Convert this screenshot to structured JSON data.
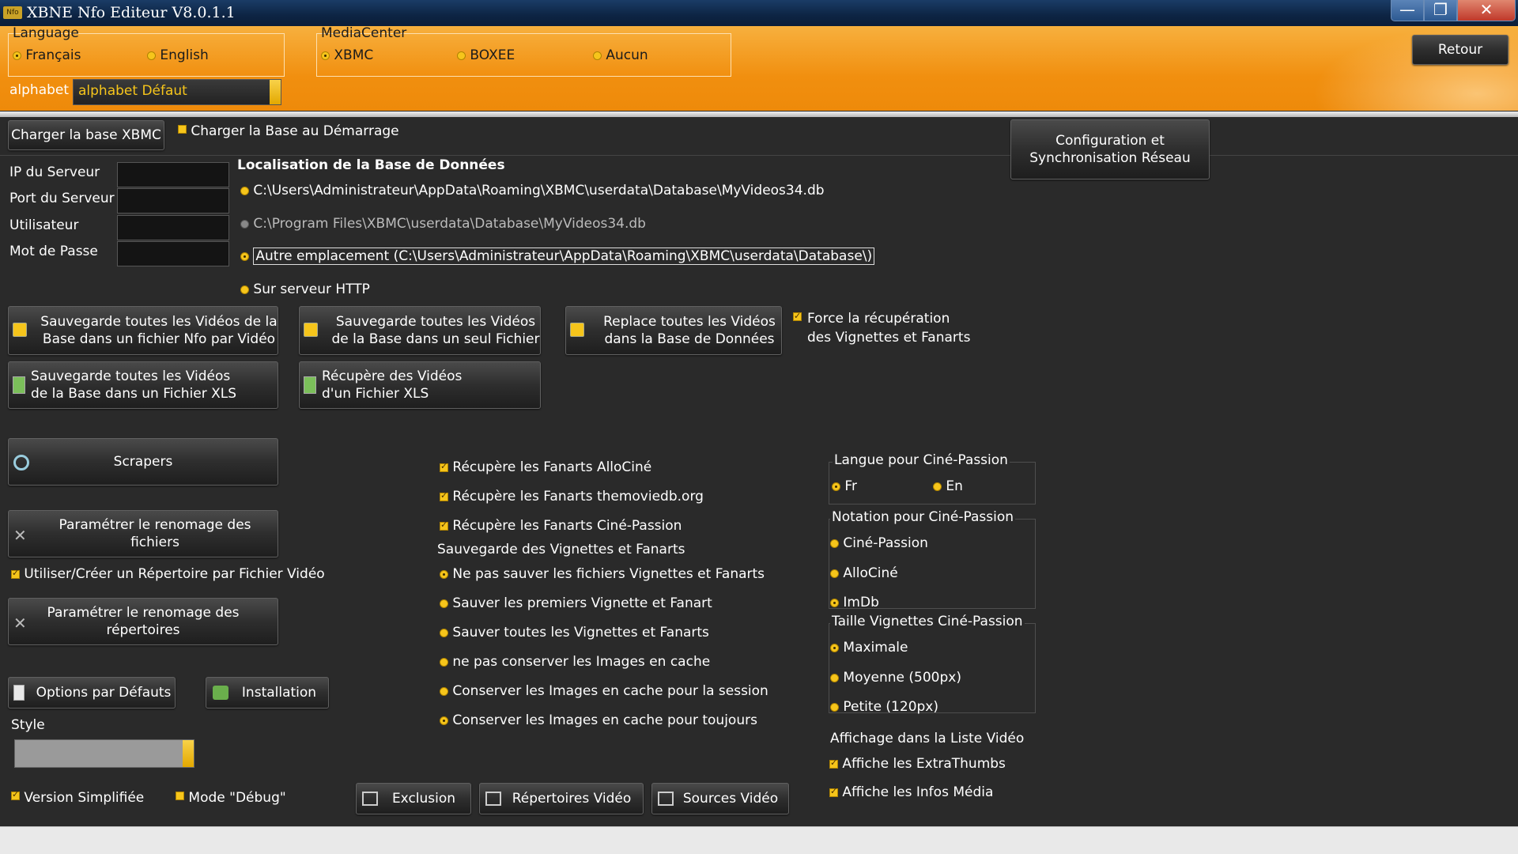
{
  "window": {
    "title": "XBNE Nfo Editeur V8.0.1.1",
    "icon_text": "Nfo",
    "minimize": "—",
    "maximize": "❐",
    "close": "✕"
  },
  "language": {
    "group_title": "Language",
    "options": [
      "Français",
      "English"
    ],
    "selected": "Français"
  },
  "mediacenter": {
    "group_title": "MediaCenter",
    "options": [
      "XBMC",
      "BOXEE",
      "Aucun"
    ],
    "selected": "XBMC"
  },
  "alphabet": {
    "label": "alphabet",
    "value": "alphabet Défaut"
  },
  "retour_button": "Retour",
  "load_base_button": "Charger la base XBMC",
  "load_on_start": "Charger la Base au Démarrage",
  "network_config_button": {
    "line1": "Configuration et",
    "line2": "Synchronisation Réseau"
  },
  "server": {
    "ip_label": "IP du Serveur",
    "port_label": "Port du Serveur",
    "user_label": "Utilisateur",
    "password_label": "Mot de Passe"
  },
  "db_location": {
    "title": "Localisation de la Base de Données",
    "options": [
      "C:\\Users\\Administrateur\\AppData\\Roaming\\XBMC\\userdata\\Database\\MyVideos34.db",
      "C:\\Program Files\\XBMC\\userdata\\Database\\MyVideos34.db",
      "Autre emplacement (C:\\Users\\Administrateur\\AppData\\Roaming\\XBMC\\userdata\\Database\\)",
      "Sur serveur HTTP"
    ]
  },
  "actions": {
    "save_nfo_per_video": {
      "line1": "Sauvegarde toutes les Vidéos de la",
      "line2": "Base dans un fichier Nfo par Vidéo"
    },
    "save_single_file": {
      "line1": "Sauvegarde toutes les Vidéos",
      "line2": "de la Base dans un seul Fichier"
    },
    "replace_videos": {
      "line1": "Replace toutes les Vidéos",
      "line2": "dans la Base de Données"
    },
    "force_fetch": {
      "line1": "Force la récupération",
      "line2": "des Vignettes et Fanarts"
    },
    "save_xls": {
      "line1": "Sauvegarde toutes les Vidéos",
      "line2": "de la Base dans un Fichier XLS"
    },
    "load_xls": {
      "line1": "Récupère des Vidéos",
      "line2": "d'un Fichier XLS"
    }
  },
  "scrapers_button": "Scrapers",
  "rename_files_button": "Paramétrer le renomage des fichiers",
  "use_dir_per_video": "Utiliser/Créer un Répertoire par Fichier Vidéo",
  "rename_dirs_button": {
    "line1": "Paramétrer le renomage des",
    "line2": "répertoires"
  },
  "defaults_button": "Options par Défauts",
  "install_button": "Installation",
  "style_label": "Style",
  "simplified_version": "Version Simplifiée",
  "debug_mode": "Mode \"Débug\"",
  "fanarts": {
    "allocine": "Récupère les Fanarts AlloCiné",
    "tmdb": "Récupère les Fanarts themoviedb.org",
    "cinepassion": "Récupère les Fanarts Ciné-Passion"
  },
  "thumb_save": {
    "title": "Sauvegarde des Vignettes et Fanarts",
    "options": [
      "Ne pas sauver les fichiers Vignettes et Fanarts",
      "Sauver les premiers Vignette et Fanart",
      "Sauver toutes les Vignettes et Fanarts",
      "ne pas conserver les Images en cache",
      "Conserver les Images en cache pour la session",
      "Conserver les Images en cache pour toujours"
    ]
  },
  "bottom_buttons": {
    "exclusion": "Exclusion",
    "video_dirs": "Répertoires Vidéo",
    "video_sources": "Sources Vidéo"
  },
  "cp_language": {
    "title": "Langue pour Ciné-Passion",
    "options": [
      "Fr",
      "En"
    ]
  },
  "cp_rating": {
    "title": "Notation pour Ciné-Passion",
    "options": [
      "Ciné-Passion",
      "AlloCiné",
      "ImDb"
    ]
  },
  "cp_thumb_size": {
    "title": "Taille Vignettes Ciné-Passion",
    "options": [
      "Maximale",
      "Moyenne (500px)",
      "Petite (120px)"
    ]
  },
  "list_display": {
    "title": "Affichage dans la Liste Vidéo",
    "extrathumbs": "Affiche les ExtraThumbs",
    "media_info": "Affiche les Infos Média"
  },
  "colors": {
    "accent_orange": "#f18f0f",
    "radio_yellow": "#f6c51b",
    "background": "#2a2a2a"
  }
}
